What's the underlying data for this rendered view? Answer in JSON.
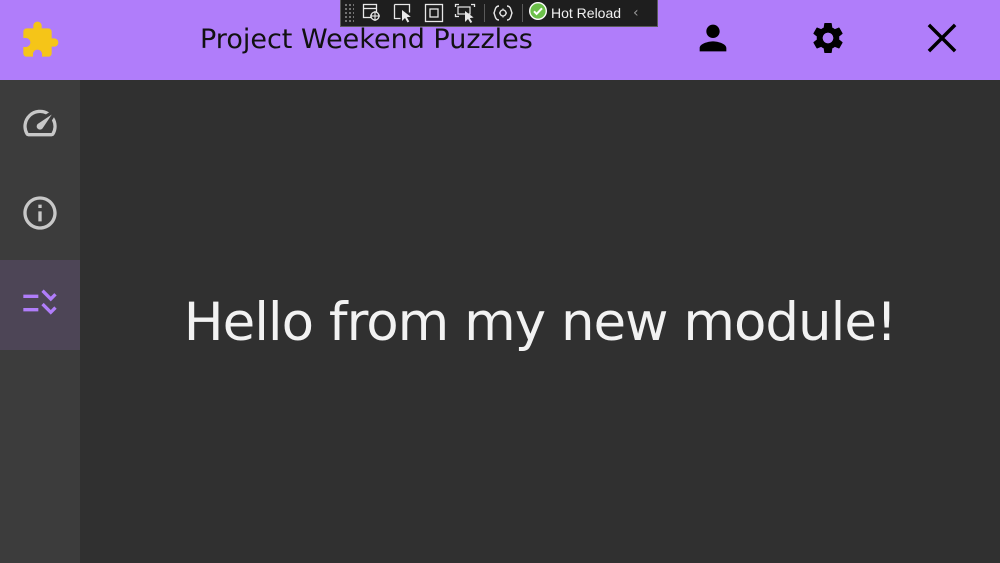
{
  "app": {
    "title": "Project Weekend Puzzles",
    "icon": "puzzle-piece-icon",
    "accent_color": "#b07dfa",
    "icon_color": "#f5c518"
  },
  "header": {
    "actions": [
      {
        "name": "user-button",
        "icon": "person-icon"
      },
      {
        "name": "settings-button",
        "icon": "gear-icon"
      },
      {
        "name": "close-button",
        "icon": "close-icon"
      }
    ]
  },
  "dev_toolbar": {
    "tools": [
      "select-element-icon",
      "pointer-icon",
      "layout-adorners-icon",
      "track-focus-icon",
      "binding-failures-icon"
    ],
    "hot_reload_label": "Hot Reload",
    "hot_reload_status_color": "#6cc04a",
    "collapse_glyph": "‹"
  },
  "sidebar": {
    "items": [
      {
        "name": "dashboard",
        "icon": "speedometer-icon",
        "active": false
      },
      {
        "name": "info",
        "icon": "info-icon",
        "active": false
      },
      {
        "name": "tasks",
        "icon": "task-checklist-icon",
        "active": true
      }
    ],
    "active_color": "#b07dfa",
    "inactive_color": "#c8c8c8"
  },
  "main": {
    "headline": "Hello from my new module!"
  }
}
